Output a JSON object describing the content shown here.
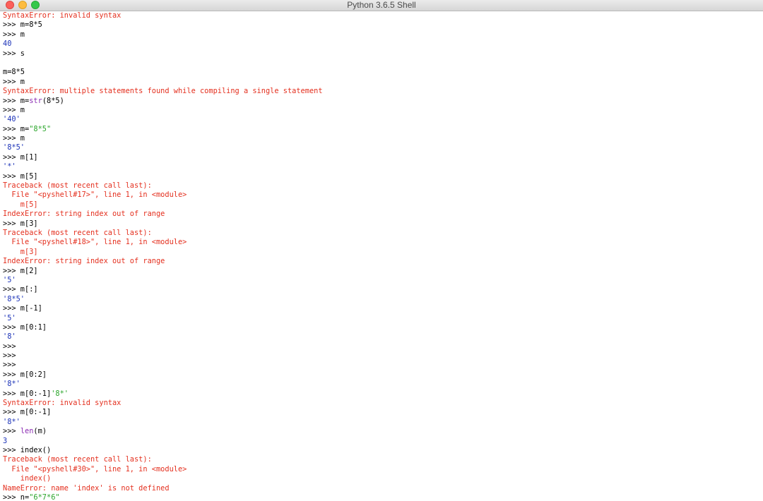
{
  "window": {
    "title": "Python 3.6.5 Shell"
  },
  "colors": {
    "error": "#e4301f",
    "output": "#1c33b8",
    "input": "#000000",
    "string": "#2aa52a",
    "builtin": "#8b2bb3"
  },
  "console": {
    "lines": [
      [
        {
          "t": "SyntaxError: invalid syntax",
          "c": "err"
        }
      ],
      [
        {
          "t": ">>> m=8*5",
          "c": "blk"
        }
      ],
      [
        {
          "t": ">>> m",
          "c": "blk"
        }
      ],
      [
        {
          "t": "40",
          "c": "out"
        }
      ],
      [
        {
          "t": ">>> s",
          "c": "blk"
        }
      ],
      [],
      [
        {
          "t": "m=8*5",
          "c": "blk"
        }
      ],
      [
        {
          "t": ">>> m",
          "c": "blk"
        }
      ],
      [
        {
          "t": "SyntaxError: multiple statements found while compiling a single statement",
          "c": "err"
        }
      ],
      [
        {
          "t": ">>> m=",
          "c": "blk"
        },
        {
          "t": "str",
          "c": "blt"
        },
        {
          "t": "(8*5)",
          "c": "blk"
        }
      ],
      [
        {
          "t": ">>> m",
          "c": "blk"
        }
      ],
      [
        {
          "t": "'40'",
          "c": "out"
        }
      ],
      [
        {
          "t": ">>> m=",
          "c": "blk"
        },
        {
          "t": "\"8*5\"",
          "c": "str"
        }
      ],
      [
        {
          "t": ">>> m",
          "c": "blk"
        }
      ],
      [
        {
          "t": "'8*5'",
          "c": "out"
        }
      ],
      [
        {
          "t": ">>> m[1]",
          "c": "blk"
        }
      ],
      [
        {
          "t": "'*'",
          "c": "out"
        }
      ],
      [
        {
          "t": ">>> m[5]",
          "c": "blk"
        }
      ],
      [
        {
          "t": "Traceback (most recent call last):",
          "c": "err"
        }
      ],
      [
        {
          "t": "  File \"<pyshell#17>\", line 1, in <module>",
          "c": "err"
        }
      ],
      [
        {
          "t": "    m[5]",
          "c": "err"
        }
      ],
      [
        {
          "t": "IndexError: string index out of range",
          "c": "err"
        }
      ],
      [
        {
          "t": ">>> m[3]",
          "c": "blk"
        }
      ],
      [
        {
          "t": "Traceback (most recent call last):",
          "c": "err"
        }
      ],
      [
        {
          "t": "  File \"<pyshell#18>\", line 1, in <module>",
          "c": "err"
        }
      ],
      [
        {
          "t": "    m[3]",
          "c": "err"
        }
      ],
      [
        {
          "t": "IndexError: string index out of range",
          "c": "err"
        }
      ],
      [
        {
          "t": ">>> m[2]",
          "c": "blk"
        }
      ],
      [
        {
          "t": "'5'",
          "c": "out"
        }
      ],
      [
        {
          "t": ">>> m[:]",
          "c": "blk"
        }
      ],
      [
        {
          "t": "'8*5'",
          "c": "out"
        }
      ],
      [
        {
          "t": ">>> m[-1]",
          "c": "blk"
        }
      ],
      [
        {
          "t": "'5'",
          "c": "out"
        }
      ],
      [
        {
          "t": ">>> m[0:1]",
          "c": "blk"
        }
      ],
      [
        {
          "t": "'8'",
          "c": "out"
        }
      ],
      [
        {
          "t": ">>>",
          "c": "blk"
        }
      ],
      [
        {
          "t": ">>>",
          "c": "blk"
        }
      ],
      [
        {
          "t": ">>>",
          "c": "blk"
        }
      ],
      [
        {
          "t": ">>> m[0:2]",
          "c": "blk"
        }
      ],
      [
        {
          "t": "'8*'",
          "c": "out"
        }
      ],
      [
        {
          "t": ">>> m[0:-1]",
          "c": "blk"
        },
        {
          "t": "'8*'",
          "c": "str"
        }
      ],
      [
        {
          "t": "SyntaxError: invalid syntax",
          "c": "err"
        }
      ],
      [
        {
          "t": ">>> m[0:-1]",
          "c": "blk"
        }
      ],
      [
        {
          "t": "'8*'",
          "c": "out"
        }
      ],
      [
        {
          "t": ">>> ",
          "c": "blk"
        },
        {
          "t": "len",
          "c": "blt"
        },
        {
          "t": "(m)",
          "c": "blk"
        }
      ],
      [
        {
          "t": "3",
          "c": "out"
        }
      ],
      [
        {
          "t": ">>> index()",
          "c": "blk"
        }
      ],
      [
        {
          "t": "Traceback (most recent call last):",
          "c": "err"
        }
      ],
      [
        {
          "t": "  File \"<pyshell#30>\", line 1, in <module>",
          "c": "err"
        }
      ],
      [
        {
          "t": "    index()",
          "c": "err"
        }
      ],
      [
        {
          "t": "NameError: name 'index' is not defined",
          "c": "err"
        }
      ],
      [
        {
          "t": ">>> n=",
          "c": "blk"
        },
        {
          "t": "\"6*7*6\"",
          "c": "str"
        }
      ]
    ]
  }
}
